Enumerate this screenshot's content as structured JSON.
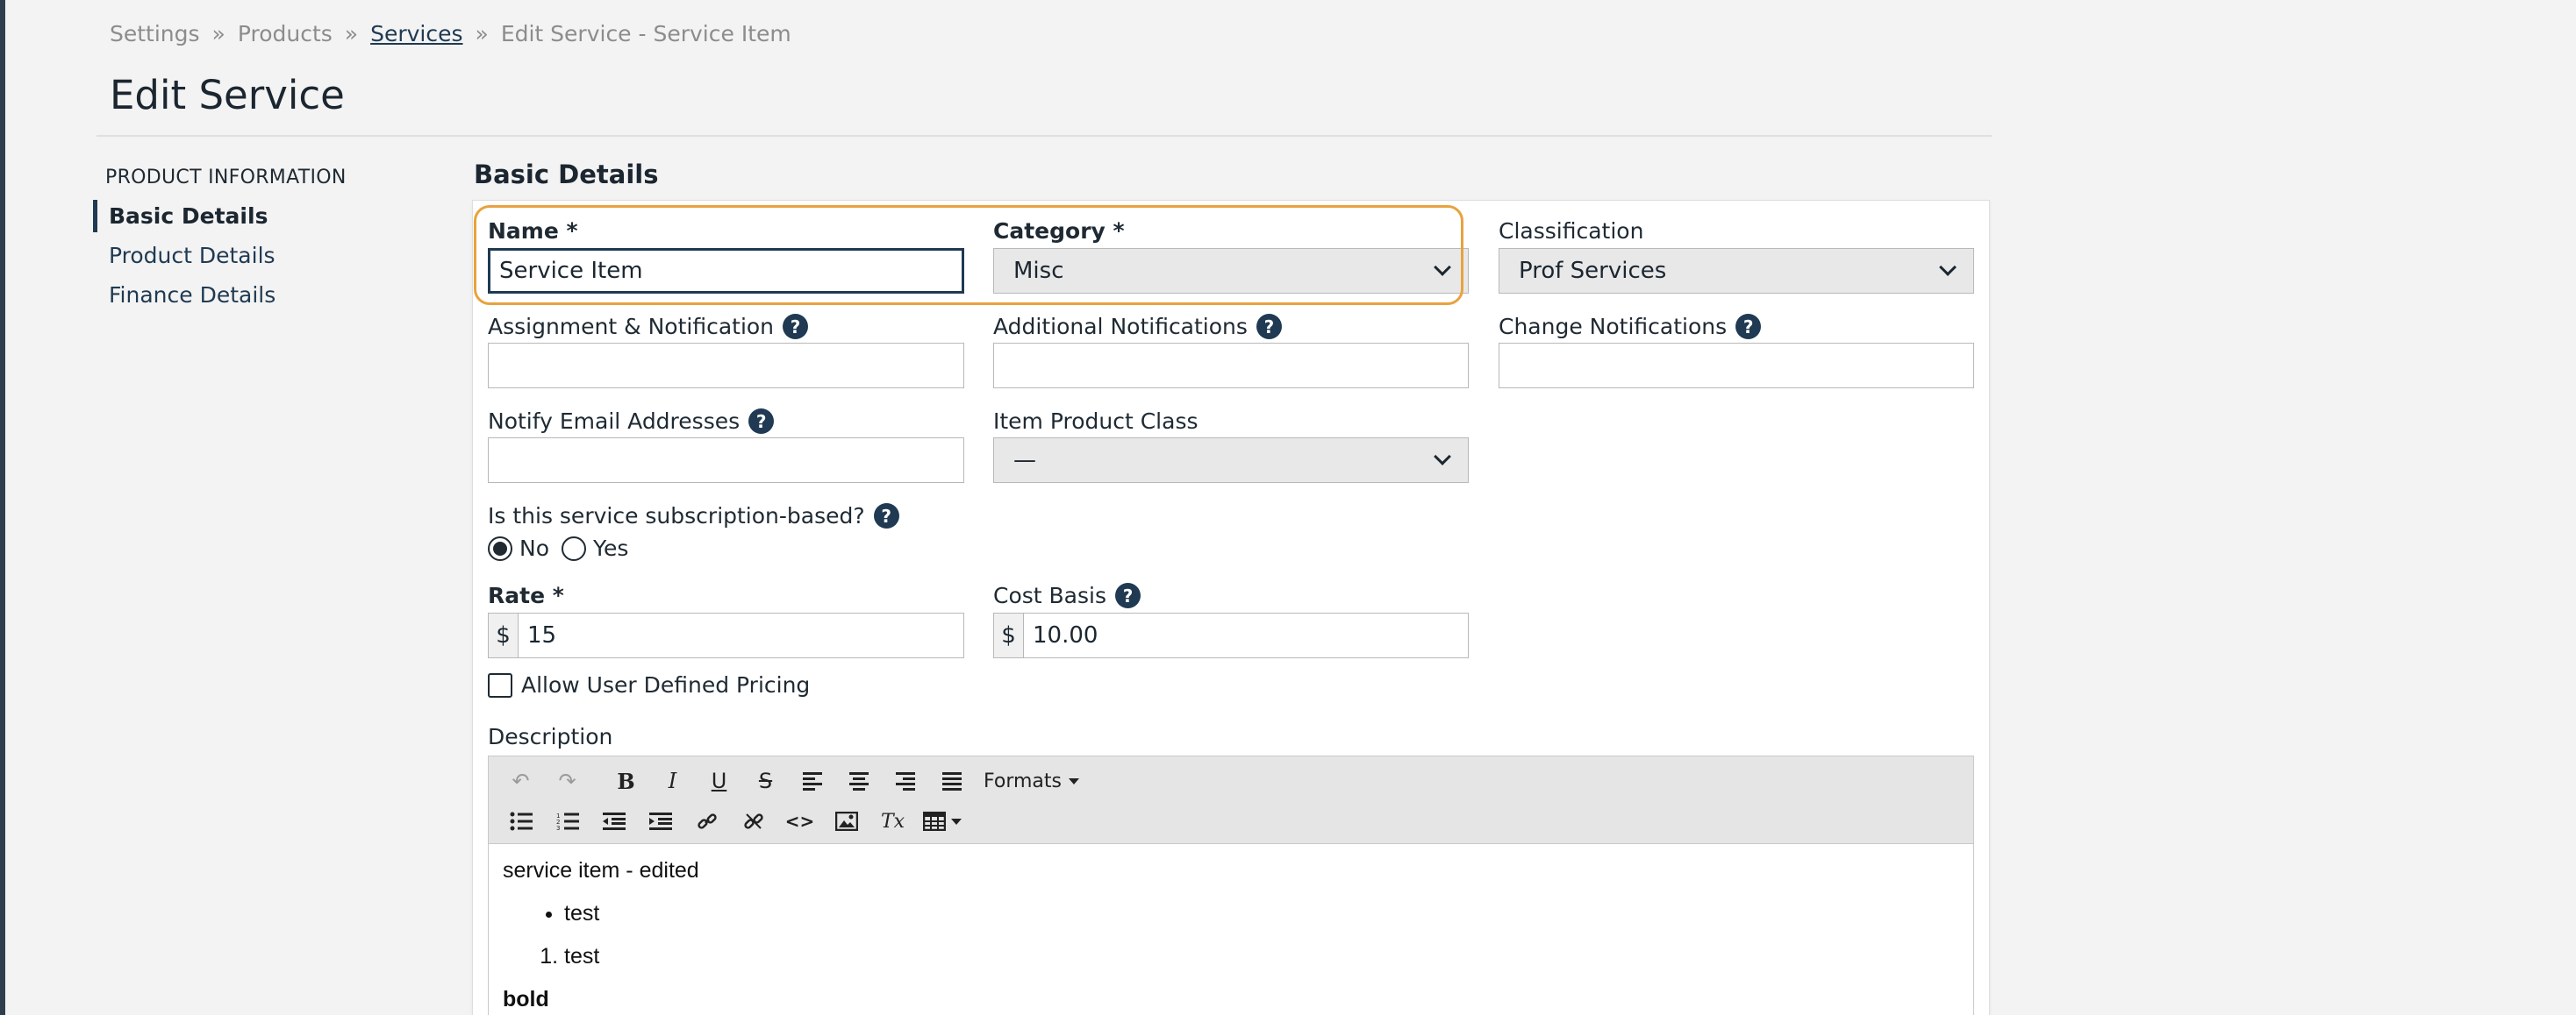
{
  "breadcrumb": {
    "items": [
      "Settings",
      "Products",
      "Services",
      "Edit Service - Service Item"
    ],
    "separator": "»"
  },
  "page": {
    "title": "Edit Service"
  },
  "nav": {
    "heading": "PRODUCT INFORMATION",
    "items": [
      "Basic Details",
      "Product Details",
      "Finance Details"
    ],
    "active": "Basic Details"
  },
  "section": {
    "title": "Basic Details"
  },
  "form": {
    "name": {
      "label": "Name *",
      "value": "Service Item"
    },
    "category": {
      "label": "Category *",
      "value": "Misc"
    },
    "classification": {
      "label": "Classification",
      "value": "Prof Services"
    },
    "assignment": {
      "label": "Assignment & Notification",
      "value": ""
    },
    "additional_notifications": {
      "label": "Additional Notifications",
      "value": ""
    },
    "change_notifications": {
      "label": "Change Notifications",
      "value": ""
    },
    "notify_emails": {
      "label": "Notify Email Addresses",
      "value": ""
    },
    "item_product_class": {
      "label": "Item Product Class",
      "value": "—"
    },
    "subscription": {
      "label": "Is this service subscription-based?",
      "options": [
        "No",
        "Yes"
      ],
      "selected": "No"
    },
    "rate": {
      "label": "Rate *",
      "prefix": "$",
      "value": "15"
    },
    "cost_basis": {
      "label": "Cost Basis",
      "prefix": "$",
      "value": "10.00"
    },
    "allow_user_pricing": {
      "label": "Allow User Defined Pricing",
      "checked": false
    },
    "description": {
      "label": "Description",
      "formats_label": "Formats",
      "paragraph": "service item - edited",
      "bullet_item": "test",
      "numbered_item": "test",
      "bold_text": "bold"
    }
  },
  "icons": {
    "help": "?",
    "undo": "↶",
    "redo": "↷",
    "bold": "B",
    "italic": "I",
    "underline": "U",
    "strike": "S",
    "code": "<>",
    "clear": "Tx"
  },
  "colors": {
    "accent": "#1f3a52",
    "highlight": "#e8a23f",
    "background": "#f3f3f3"
  }
}
